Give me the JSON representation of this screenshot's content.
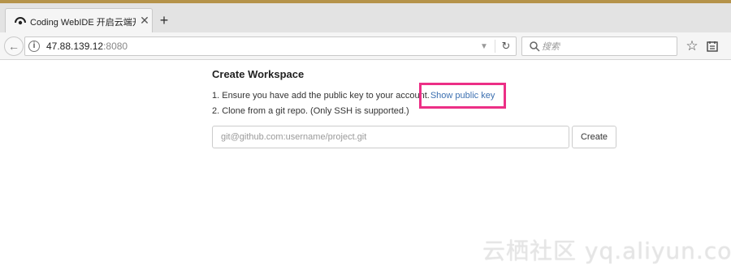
{
  "browser": {
    "tab": {
      "title": "Coding WebIDE 开启云端开发",
      "close_glyph": "✕"
    },
    "new_tab_glyph": "+",
    "url": {
      "host": "47.88.139.12",
      "port": ":8080"
    },
    "search": {
      "placeholder": "搜索"
    }
  },
  "page": {
    "heading": "Create Workspace",
    "step1_text": "1. Ensure you have add the public key to your account.",
    "step1_link": "Show public key",
    "step2_text": "2. Clone from a git repo. (Only SSH is supported.)",
    "repo_input": {
      "placeholder": "git@github.com:username/project.git",
      "value": ""
    },
    "create_button": "Create"
  },
  "watermark": "云栖社区 yq.aliyun.com",
  "colors": {
    "highlight": "#ec2f86",
    "link": "#3b6fb0",
    "top_strip": "#b5934a"
  },
  "icons": [
    "logo-icon",
    "close-icon",
    "plus-icon",
    "back-arrow-icon",
    "info-icon",
    "dropdown-icon",
    "reload-icon",
    "search-icon",
    "star-icon",
    "reading-list-icon"
  ]
}
